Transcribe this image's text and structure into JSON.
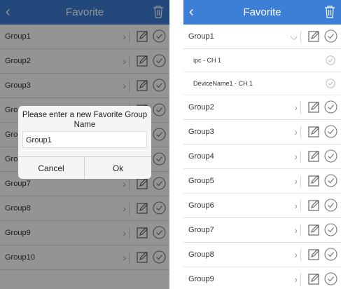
{
  "left": {
    "header": {
      "back_icon": "chevron-left-icon",
      "title": "Favorite",
      "trash_icon": "trash-icon"
    },
    "groups": [
      {
        "name": "Group1"
      },
      {
        "name": "Group2"
      },
      {
        "name": "Group3"
      },
      {
        "name": "Group4"
      },
      {
        "name": "Group5"
      },
      {
        "name": "Group6"
      },
      {
        "name": "Group7"
      },
      {
        "name": "Group8"
      },
      {
        "name": "Group9"
      },
      {
        "name": "Group10"
      }
    ],
    "dialog": {
      "title": "Please enter a new Favorite Group Name",
      "input_value": "Group1",
      "cancel": "Cancel",
      "ok": "Ok"
    }
  },
  "right": {
    "header": {
      "back_icon": "chevron-left-icon",
      "title": "Favorite",
      "trash_icon": "trash-icon"
    },
    "expanded_group": {
      "name": "Group1",
      "channels": [
        {
          "name": "ipc - CH 1"
        },
        {
          "name": "DeviceName1 - CH 1"
        }
      ]
    },
    "groups": [
      {
        "name": "Group2"
      },
      {
        "name": "Group3"
      },
      {
        "name": "Group4"
      },
      {
        "name": "Group5"
      },
      {
        "name": "Group6"
      },
      {
        "name": "Group7"
      },
      {
        "name": "Group8"
      },
      {
        "name": "Group9"
      }
    ]
  },
  "colors": {
    "accent": "#3d7fd6",
    "overlay": "rgba(0,0,0,0.42)"
  }
}
